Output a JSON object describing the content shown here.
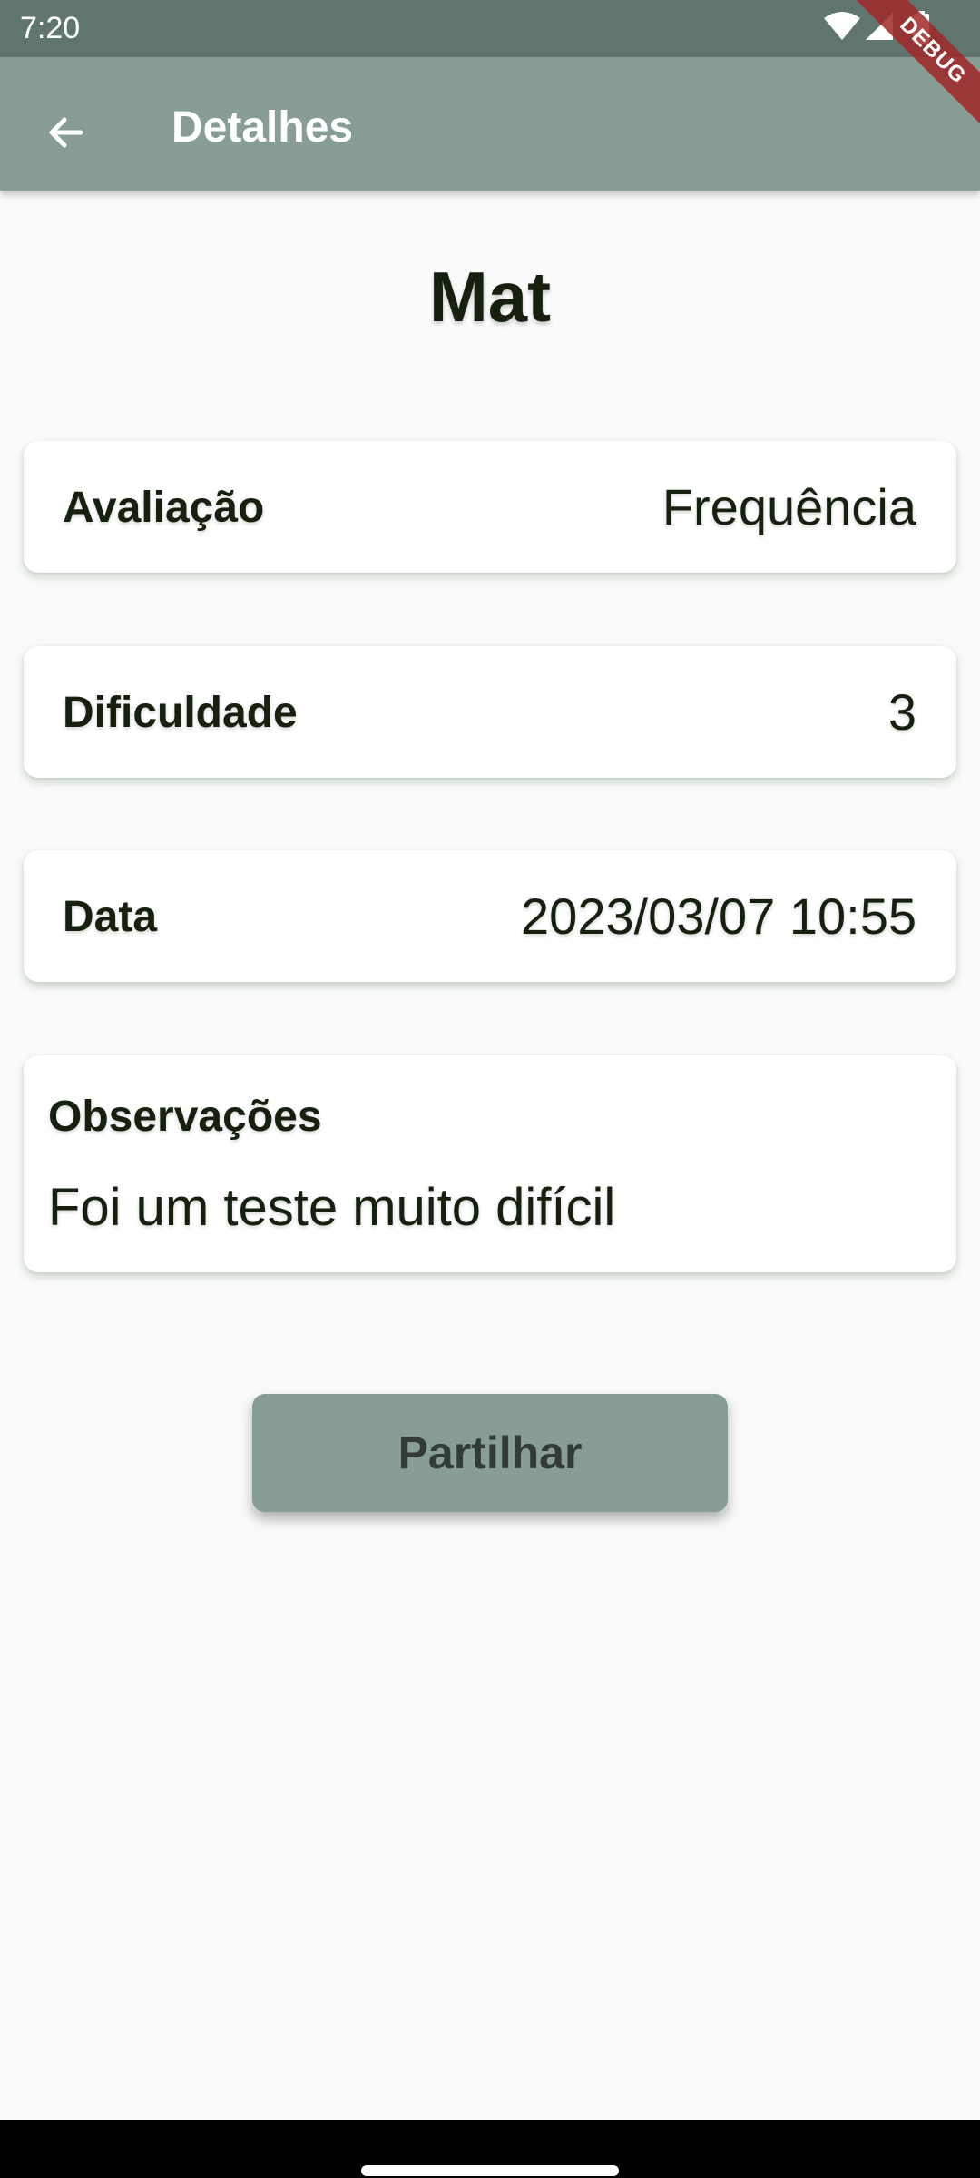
{
  "status_bar": {
    "time": "7:20",
    "icons": [
      "wifi-icon",
      "cellular-signal-icon",
      "battery-icon"
    ]
  },
  "debug_banner": {
    "label": "DEBUG"
  },
  "app_bar": {
    "title": "Detalhes",
    "back_icon": "arrow-back-icon"
  },
  "subject": {
    "title": "Mat"
  },
  "details": [
    {
      "label": "Avaliação",
      "value": "Frequência"
    },
    {
      "label": "Dificuldade",
      "value": "3"
    },
    {
      "label": "Data",
      "value": "2023/03/07 10:55"
    }
  ],
  "notes": {
    "label": "Observações",
    "text": "Foi um teste muito difícil"
  },
  "actions": {
    "share_label": "Partilhar"
  },
  "colors": {
    "status_bar": "#607570",
    "app_bar": "#879d96",
    "background": "#fafafa",
    "text": "#15200f",
    "button": "#879d96"
  }
}
